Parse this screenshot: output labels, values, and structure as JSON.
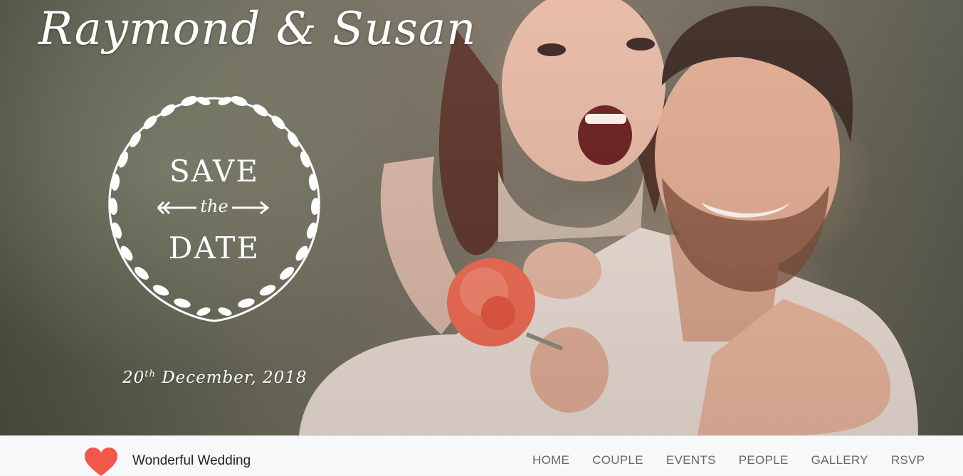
{
  "hero": {
    "title": "Raymond & Susan",
    "badge": {
      "save": "SAVE",
      "the": "the",
      "date": "DATE"
    },
    "date": {
      "day": "20",
      "suffix": "th",
      "rest": "December, 2018"
    }
  },
  "navbar": {
    "brand": "Wonderful Wedding",
    "brand_icon": "heart-icon",
    "links": [
      "HOME",
      "COUPLE",
      "EVENTS",
      "PEOPLE",
      "GALLERY",
      "RSVP"
    ]
  },
  "colors": {
    "heart": "#f2584a",
    "text_white": "#ffffff",
    "nav_text": "#666666"
  }
}
